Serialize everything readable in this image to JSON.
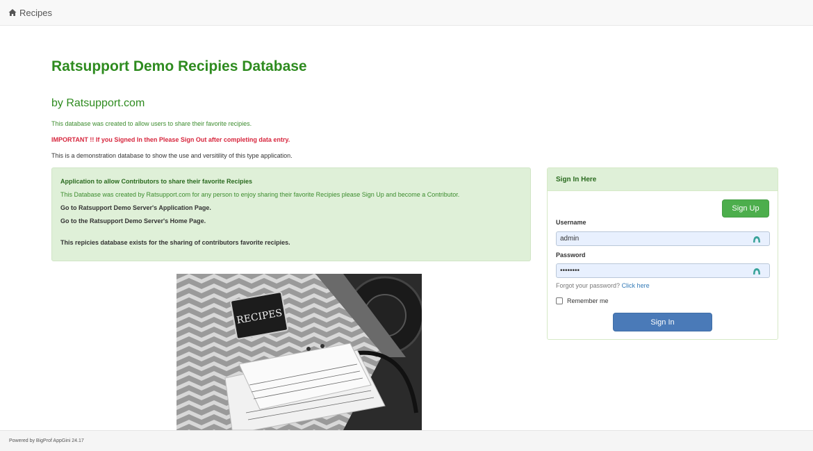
{
  "navbar": {
    "brand_label": "Recipes",
    "brand_icon": "home-icon"
  },
  "header": {
    "title": "Ratsupport Demo Recipies Database",
    "subtitle": "by Ratsupport.com"
  },
  "intro": {
    "line1": "This database was created to allow users to share their favorite recipies.",
    "line2": "IMPORTANT !! If you Signed In then Please Sign Out after completing data entry.",
    "line3": "This is a demonstration database to show the use and versitility of this type application."
  },
  "info_panel": {
    "heading": "Application to allow Contributors to share their favorite Recipies",
    "description": "This Database was created by Ratsupport.com for any person to enjoy sharing their favorite Recipies please Sign Up and become a Contributor.",
    "link_app": "Go to Ratsupport Demo Server's Application Page.",
    "link_home": "Go to the Ratsupport Demo Server's Home Page.",
    "note": "This repicies database exists for the sharing of contributors favorite recipies."
  },
  "photo": {
    "binder_label": "RECIPES"
  },
  "signin": {
    "heading": "Sign In Here",
    "signup_label": "Sign Up",
    "username_label": "Username",
    "username_value": "admin",
    "password_label": "Password",
    "password_value": "••••••••",
    "forgot_text": "Forgot your password?",
    "forgot_link": "Click here",
    "remember_label": "Remember me",
    "signin_label": "Sign In"
  },
  "footer": {
    "text": "Powered by BigProf AppGini 24.17"
  },
  "colors": {
    "heading_green": "#2e8b1f",
    "panel_green": "#dff0d8",
    "important_red": "#d7263d",
    "signup_green": "#4cae4c",
    "signin_blue": "#4a7ab8",
    "link_blue": "#337ab7"
  }
}
